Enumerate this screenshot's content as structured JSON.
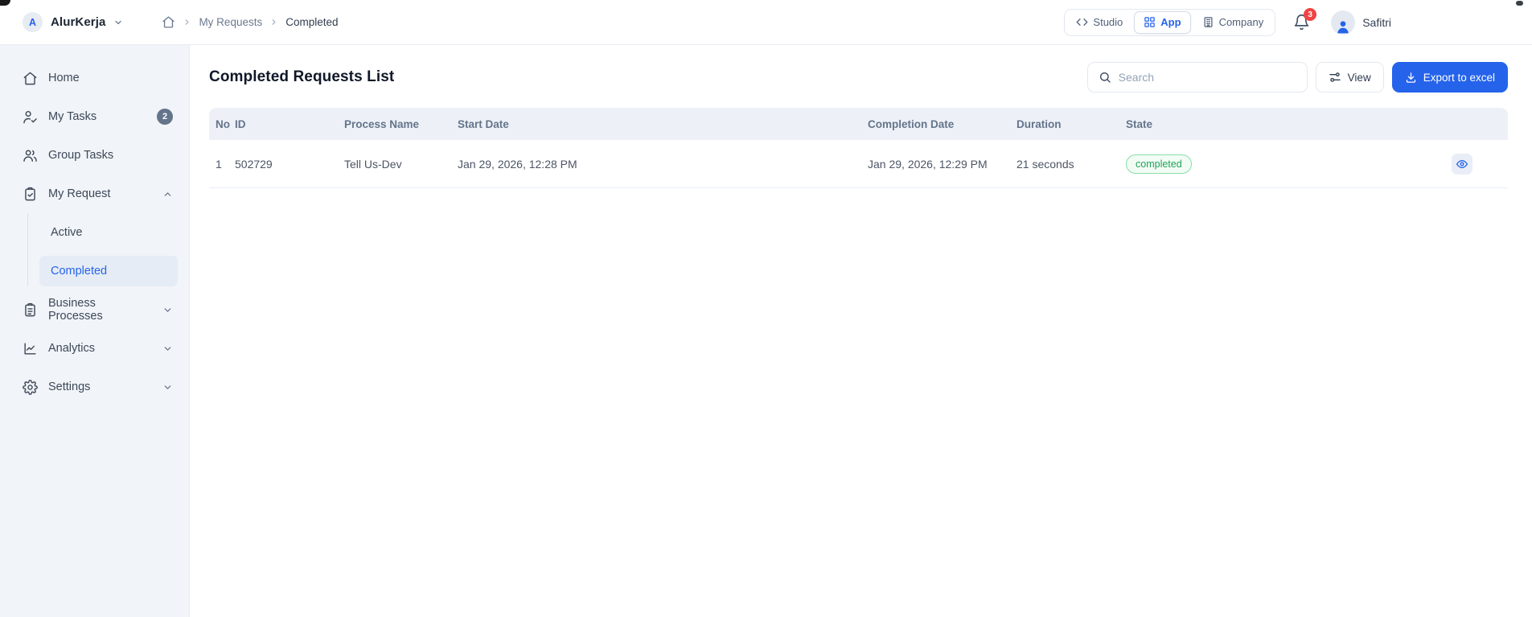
{
  "header": {
    "brand": {
      "initial": "A",
      "name": "AlurKerja",
      "dropdown_icon": "chevron-down-icon"
    },
    "breadcrumb": {
      "home_icon": "home-icon",
      "items": [
        "My Requests",
        "Completed"
      ]
    },
    "workspace_switcher": [
      {
        "label": "Studio",
        "icon": "code-icon",
        "active": false
      },
      {
        "label": "App",
        "icon": "grid-icon",
        "active": true
      },
      {
        "label": "Company",
        "icon": "building-icon",
        "active": false
      }
    ],
    "notifications": {
      "icon": "bell-icon",
      "badge": "3"
    },
    "user": {
      "name": "Safitri",
      "icon": "person-icon"
    }
  },
  "sidebar": {
    "items": [
      {
        "label": "Home",
        "icon": "home-icon"
      },
      {
        "label": "My Tasks",
        "icon": "user-check-icon",
        "badge": "2"
      },
      {
        "label": "Group Tasks",
        "icon": "users-icon"
      },
      {
        "label": "My Request",
        "icon": "clipboard-check-icon",
        "expanded": true,
        "children": [
          {
            "label": "Active",
            "active": false
          },
          {
            "label": "Completed",
            "active": true
          }
        ]
      },
      {
        "label": "Business Processes",
        "icon": "clipboard-list-icon",
        "expanded": false
      },
      {
        "label": "Analytics",
        "icon": "line-chart-icon",
        "expanded": false
      },
      {
        "label": "Settings",
        "icon": "gear-icon",
        "expanded": false
      }
    ]
  },
  "main": {
    "title": "Completed Requests List",
    "search": {
      "placeholder": "Search",
      "value": "",
      "icon": "search-icon"
    },
    "view_button": {
      "label": "View",
      "icon": "sliders-icon"
    },
    "export_button": {
      "label": "Export to excel",
      "icon": "download-icon"
    },
    "table": {
      "columns": [
        "No",
        "ID",
        "Process Name",
        "Start Date",
        "Completion Date",
        "Duration",
        "State"
      ],
      "rows": [
        {
          "no": "1",
          "id": "502729",
          "process_name": "Tell Us-Dev",
          "start_date": "Jan 29, 2026, 12:28 PM",
          "completion_date": "Jan 29, 2026, 12:29 PM",
          "duration": "21 seconds",
          "state": "completed",
          "action_icon": "eye-icon"
        }
      ]
    }
  },
  "colors": {
    "accent": "#2563eb",
    "sidebar_bg": "#f1f4f8",
    "table_header_bg": "#edf1f7",
    "state_completed_text": "#1ea456",
    "state_completed_border": "#86dfa6",
    "state_completed_bg": "#f2fcf5",
    "notification_badge_bg": "#ef4444",
    "my_tasks_badge_bg": "#64748b"
  }
}
